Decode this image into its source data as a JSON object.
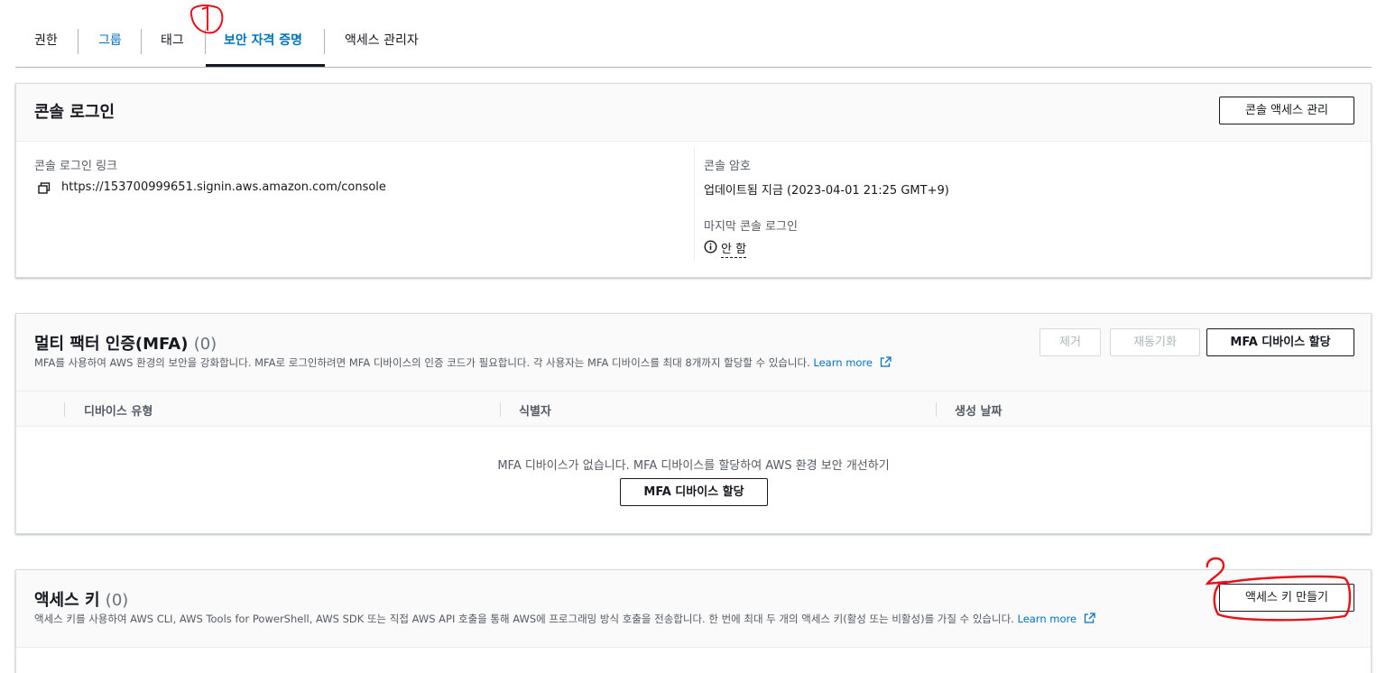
{
  "tabs": [
    {
      "label": "권한"
    },
    {
      "label": "그룹"
    },
    {
      "label": "태그"
    },
    {
      "label": "보안 자격 증명"
    },
    {
      "label": "액세스 관리자"
    }
  ],
  "console": {
    "title": "콘솔 로그인",
    "manage_button": "콘솔 액세스 관리",
    "link_label": "콘솔 로그인 링크",
    "link_value": "https://153700999651.signin.aws.amazon.com/console",
    "password_label": "콘솔 암호",
    "password_value": "업데이트됨 지금 (2023-04-01 21:25 GMT+9)",
    "last_login_label": "마지막 콘솔 로그인",
    "last_login_value": "안 함"
  },
  "mfa": {
    "title": "멀티 팩터 인증(MFA)",
    "count": "(0)",
    "description": "MFA를 사용하여 AWS 환경의 보안을 강화합니다. MFA로 로그인하려면 MFA 디바이스의 인증 코드가 필요합니다. 각 사용자는 MFA 디바이스를 최대 8개까지 할당할 수 있습니다.",
    "learn_more": "Learn more",
    "remove_button": "제거",
    "resync_button": "재동기화",
    "assign_button": "MFA 디바이스 할당",
    "columns": [
      "디바이스 유형",
      "식별자",
      "생성 날짜"
    ],
    "empty_message": "MFA 디바이스가 없습니다. MFA 디바이스를 할당하여 AWS 환경 보안 개선하기",
    "empty_assign_button": "MFA 디바이스 할당"
  },
  "access_keys": {
    "title": "액세스 키",
    "count": "(0)",
    "description": "액세스 키를 사용하여 AWS CLI, AWS Tools for PowerShell, AWS SDK 또는 직접 AWS API 호출을 통해 AWS에 프로그래밍 방식 호출을 전송합니다. 한 번에 최대 두 개의 액세스 키(활성 또는 비활성)를 가질 수 있습니다.",
    "learn_more": "Learn more",
    "create_button": "액세스 키 만들기"
  },
  "annotations": {
    "mark1": "1",
    "mark2": "2",
    "color": "#e8101a"
  },
  "colors": {
    "link": "#0073bb",
    "text": "#16191f",
    "muted": "#545b64"
  }
}
